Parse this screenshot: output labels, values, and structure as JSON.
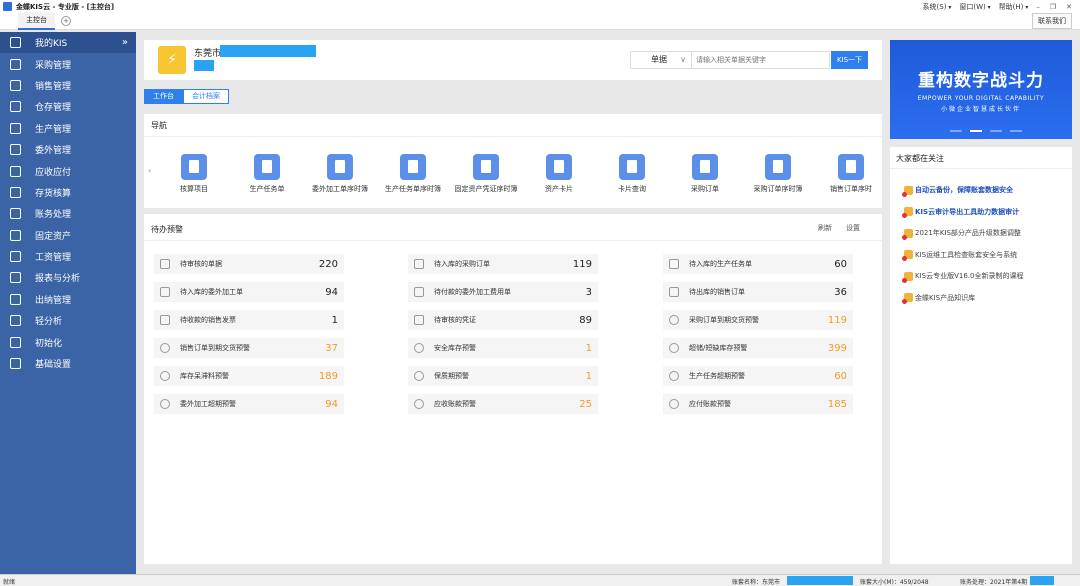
{
  "window": {
    "title": "金蝶KIS云 - 专业版 - [主控台]",
    "menus": [
      "系统(S)",
      "窗口(W)",
      "帮助(H)"
    ]
  },
  "tabs": {
    "main_tab": "主控台",
    "contact_label": "联系我们"
  },
  "sidebar": {
    "items": [
      {
        "label": "我的KIS",
        "icon": "monitor-icon"
      },
      {
        "label": "采购管理",
        "icon": "purchase-icon"
      },
      {
        "label": "销售管理",
        "icon": "sales-icon"
      },
      {
        "label": "仓存管理",
        "icon": "warehouse-icon"
      },
      {
        "label": "生产管理",
        "icon": "production-icon"
      },
      {
        "label": "委外管理",
        "icon": "outsourcing-icon"
      },
      {
        "label": "应收应付",
        "icon": "receivable-icon"
      },
      {
        "label": "存货核算",
        "icon": "inventory-icon"
      },
      {
        "label": "账务处理",
        "icon": "accounting-icon"
      },
      {
        "label": "固定资产",
        "icon": "asset-icon"
      },
      {
        "label": "工资管理",
        "icon": "payroll-icon"
      },
      {
        "label": "报表与分析",
        "icon": "report-icon"
      },
      {
        "label": "出纳管理",
        "icon": "cashier-icon"
      },
      {
        "label": "轻分析",
        "icon": "analysis-icon"
      },
      {
        "label": "初始化",
        "icon": "init-icon"
      },
      {
        "label": "基础设置",
        "icon": "settings-icon"
      }
    ],
    "collapse_glyph": "»"
  },
  "company": {
    "name": "东莞市",
    "search_type": "单据",
    "search_placeholder": "请输入相关单据关键字",
    "search_button": "KIS一下"
  },
  "subtabs": [
    "工作台",
    "会计档案"
  ],
  "navigation": {
    "title": "导航",
    "prev_glyph": "‹",
    "items": [
      "核算项目",
      "生产任务单",
      "委外加工单序时簿",
      "生产任务单序时簿",
      "固定资产凭证序时簿",
      "资产卡片",
      "卡片查询",
      "采购订单",
      "采购订单序时簿",
      "销售订单序时"
    ]
  },
  "todo": {
    "title": "待办预警",
    "refresh": "刷新",
    "settings": "设置",
    "items": [
      {
        "label": "待审核的单据",
        "value": "220",
        "kind": "doc",
        "color": "#222222"
      },
      {
        "label": "待入库的采购订单",
        "value": "119",
        "kind": "doc",
        "color": "#222222"
      },
      {
        "label": "待入库的生产任务单",
        "value": "60",
        "kind": "doc",
        "color": "#222222"
      },
      {
        "label": "待入库的委外加工单",
        "value": "94",
        "kind": "doc",
        "color": "#222222"
      },
      {
        "label": "待付款的委外加工费用单",
        "value": "3",
        "kind": "doc",
        "color": "#222222"
      },
      {
        "label": "待出库的销售订单",
        "value": "36",
        "kind": "doc",
        "color": "#222222"
      },
      {
        "label": "待收款的销售发票",
        "value": "1",
        "kind": "doc",
        "color": "#222222"
      },
      {
        "label": "待审核的凭证",
        "value": "89",
        "kind": "doc",
        "color": "#222222"
      },
      {
        "label": "采购订单到期交货预警",
        "value": "119",
        "kind": "warn",
        "color": "#f59a23"
      },
      {
        "label": "销售订单到期交货预警",
        "value": "37",
        "kind": "warn",
        "color": "#f59a23"
      },
      {
        "label": "安全库存预警",
        "value": "1",
        "kind": "warn",
        "color": "#f59a23"
      },
      {
        "label": "超储/短缺库存预警",
        "value": "399",
        "kind": "warn",
        "color": "#f59a23"
      },
      {
        "label": "库存呆滞料预警",
        "value": "189",
        "kind": "warn",
        "color": "#f59a23"
      },
      {
        "label": "保质期预警",
        "value": "1",
        "kind": "warn",
        "color": "#f59a23"
      },
      {
        "label": "生产任务超期预警",
        "value": "60",
        "kind": "warn",
        "color": "#f59a23"
      },
      {
        "label": "委外加工超期预警",
        "value": "94",
        "kind": "warn",
        "color": "#f59a23"
      },
      {
        "label": "应收账款预警",
        "value": "25",
        "kind": "warn",
        "color": "#f59a23"
      },
      {
        "label": "应付账款预警",
        "value": "185",
        "kind": "warn",
        "color": "#f59a23"
      }
    ]
  },
  "banner": {
    "headline": "重构数字战斗力",
    "english": "EMPOWER YOUR DIGITAL CAPABILITY",
    "tagline": "小微企业智慧成长伙伴"
  },
  "focus": {
    "title": "大家都在关注",
    "items": [
      {
        "label": "自动云备份，保障账套数据安全",
        "bold": true
      },
      {
        "label": "KIS云审计导出工具助力数据审计",
        "bold": true
      },
      {
        "label": "2021年KIS部分产品升级数据调整",
        "bold": false
      },
      {
        "label": "KIS运维工具检查账套安全与系统",
        "bold": false
      },
      {
        "label": "KIS云专业版V16.0全新录制的课程",
        "bold": false
      },
      {
        "label": "金蝶KIS产品知识库",
        "bold": false
      }
    ]
  },
  "statusbar": {
    "left": "就绪",
    "account_label": "账套名称：东莞市",
    "size_label": "账套大小(M)：459/2048",
    "period_label": "账务处理：2021年第4期"
  },
  "colors": {
    "sidebar": "#3b64a6",
    "accent": "#2f80ed",
    "warning_value": "#f59a23",
    "redaction": "#2aa3f5"
  }
}
